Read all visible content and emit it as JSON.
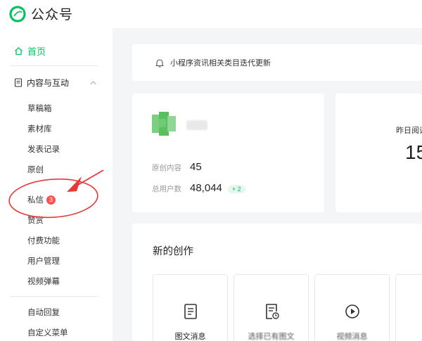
{
  "app": {
    "title": "公众号"
  },
  "sidebar": {
    "home": "首页",
    "section": "内容与互动",
    "items": [
      {
        "label": "草稿箱"
      },
      {
        "label": "素材库"
      },
      {
        "label": "发表记录"
      },
      {
        "label": "原创"
      },
      {
        "label": "私信",
        "badge": "3"
      },
      {
        "label": "赞赏"
      },
      {
        "label": "付费功能"
      },
      {
        "label": "用户管理"
      },
      {
        "label": "视频弹幕"
      },
      {
        "label": "自动回复"
      },
      {
        "label": "自定义菜单"
      }
    ]
  },
  "notice": {
    "text": "小程序资讯相关类目迭代更新"
  },
  "account": {
    "original_label": "原创内容",
    "original_value": "45",
    "users_label": "总用户数",
    "users_value": "48,044",
    "users_delta": "+ 2"
  },
  "reads": {
    "label": "昨日阅读",
    "value": "15"
  },
  "create": {
    "title": "新的创作",
    "tiles": [
      {
        "label": "图文消息",
        "icon": "document-icon"
      },
      {
        "label": "选择已有图文",
        "icon": "document-clock-icon"
      },
      {
        "label": "视频消息",
        "icon": "play-icon"
      }
    ]
  },
  "colors": {
    "accent": "#07c160",
    "badge": "#fa5151",
    "annotation": "#e53935"
  }
}
